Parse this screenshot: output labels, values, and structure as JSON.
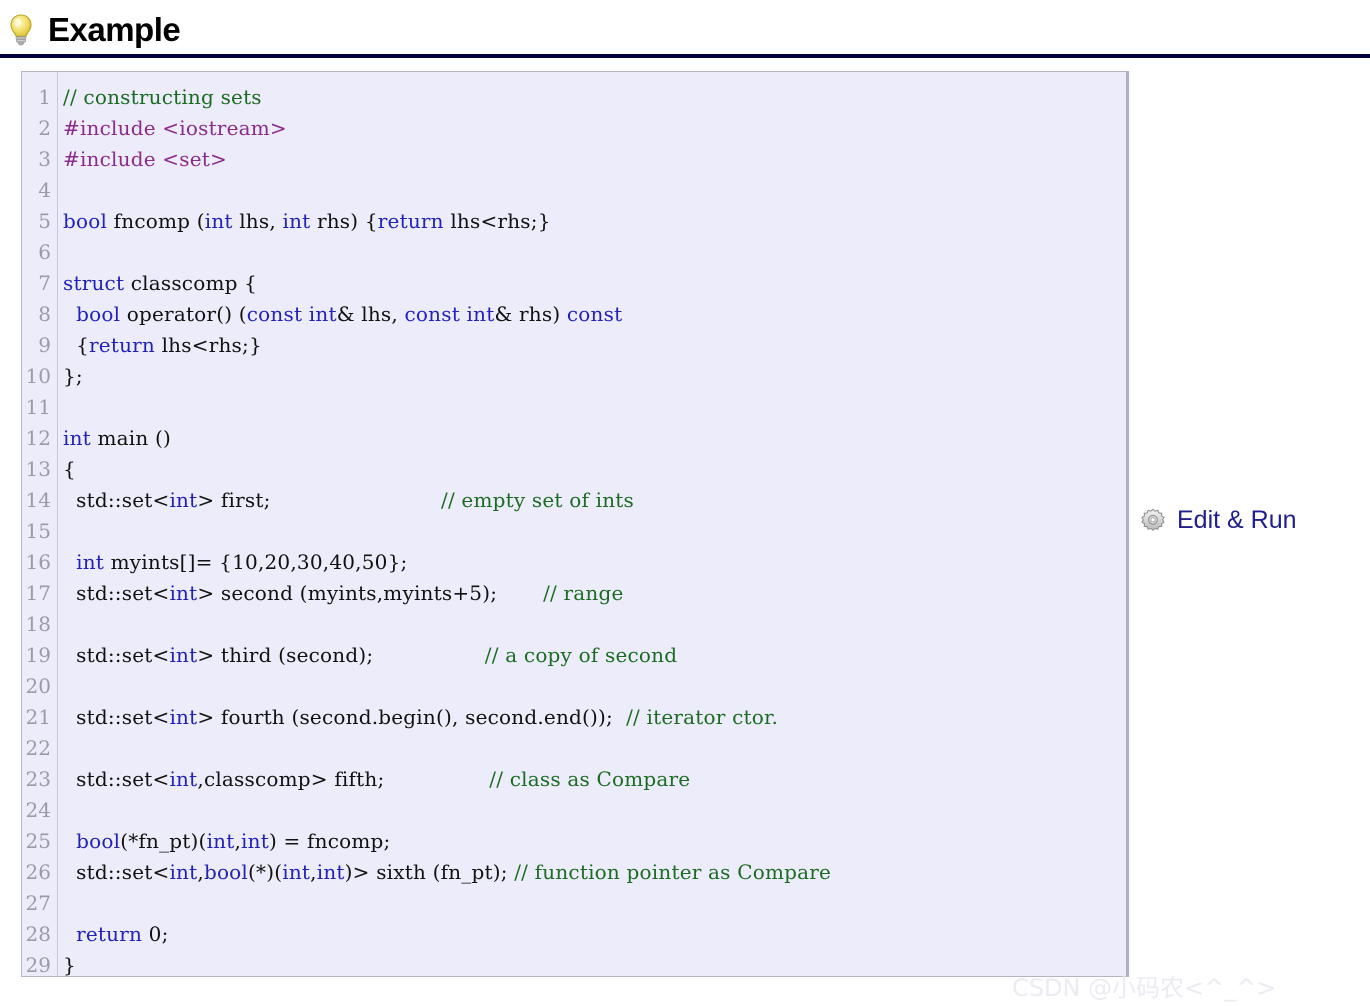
{
  "header": {
    "title": "Example",
    "icon": "lightbulb-icon",
    "rule_color": "#000040"
  },
  "code_block": {
    "background": "#ececfa",
    "border_color": "#b5b5c8",
    "gutter_color": "#9a9aa8",
    "syntax_colors": {
      "keyword": "#2222bb",
      "preprocessor": "#8b2b8b",
      "comment": "#1b6b22",
      "plain": "#111111"
    },
    "line_numbers": [
      1,
      2,
      3,
      4,
      5,
      6,
      7,
      8,
      9,
      10,
      11,
      12,
      13,
      14,
      15,
      16,
      17,
      18,
      19,
      20,
      21,
      22,
      23,
      24,
      25,
      26,
      27,
      28,
      29
    ],
    "lines": [
      "// constructing sets",
      "#include <iostream>",
      "#include <set>",
      "",
      "bool fncomp (int lhs, int rhs) {return lhs<rhs;}",
      "",
      "struct classcomp {",
      "  bool operator() (const int& lhs, const int& rhs) const",
      "  {return lhs<rhs;}",
      "};",
      "",
      "int main ()",
      "{",
      "  std::set<int> first;                          // empty set of ints",
      "",
      "  int myints[]= {10,20,30,40,50};",
      "  std::set<int> second (myints,myints+5);       // range",
      "",
      "  std::set<int> third (second);                 // a copy of second",
      "",
      "  std::set<int> fourth (second.begin(), second.end());  // iterator ctor.",
      "",
      "  std::set<int,classcomp> fifth;                // class as Compare",
      "",
      "  bool(*fn_pt)(int,int) = fncomp;",
      "  std::set<int,bool(*)(int,int)> sixth (fn_pt); // function pointer as Compare",
      "",
      "  return 0;",
      "}"
    ]
  },
  "edit_run": {
    "label": "Edit & Run",
    "icon": "gear-icon",
    "text_color": "#20208a"
  },
  "watermark": {
    "text": "CSDN @小码农<^_^>"
  }
}
